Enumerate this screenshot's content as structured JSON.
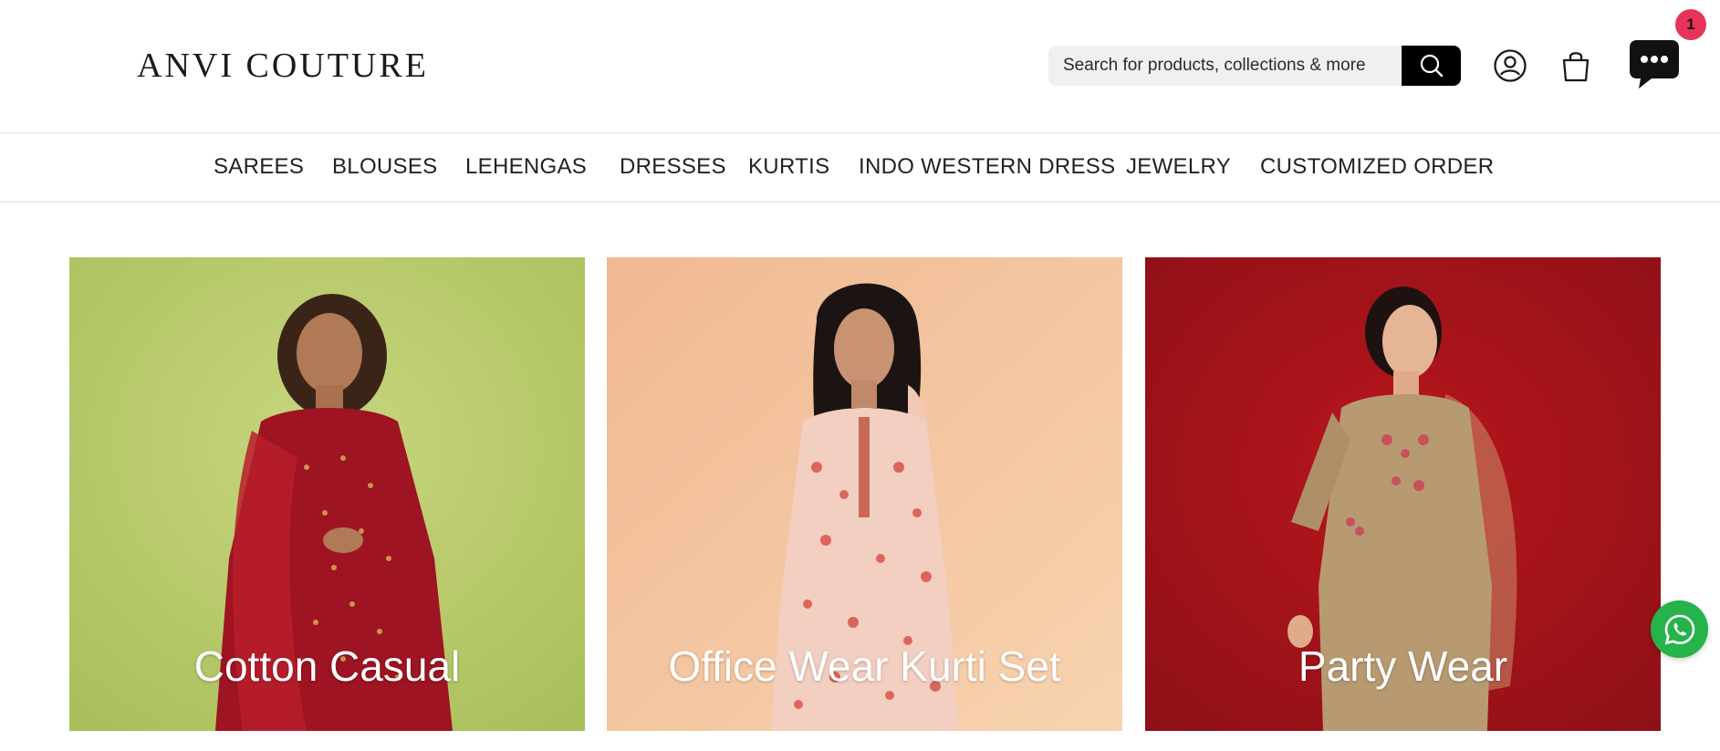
{
  "header": {
    "logo_text": "ANVI COUTURE",
    "search_placeholder": "Search for products, collections & more",
    "icons": {
      "search": "search-icon",
      "account": "user-icon",
      "cart": "shopping-bag-icon",
      "chat": "chat-bubble-icon"
    },
    "chat_badge_count": "1"
  },
  "nav": {
    "items": [
      {
        "label": "SAREES"
      },
      {
        "label": "BLOUSES"
      },
      {
        "label": "LEHENGAS"
      },
      {
        "label": "DRESSES"
      },
      {
        "label": "KURTIS"
      },
      {
        "label": "INDO WESTERN DRESS"
      },
      {
        "label": "JEWELRY"
      },
      {
        "label": "CUSTOMIZED ORDER"
      }
    ]
  },
  "collections": [
    {
      "title": "Cotton Casual",
      "background": "#bfcf72",
      "garment": "#9e1422"
    },
    {
      "title": "Office Wear Kurti Set",
      "background": "#f4c9a3",
      "garment": "#e88a77"
    },
    {
      "title": "Party Wear",
      "background": "#a8151b",
      "garment": "#b89a72"
    }
  ],
  "floating": {
    "whatsapp_icon": "whatsapp-icon"
  },
  "colors": {
    "badge": "#e8345d",
    "whatsapp": "#25b34a",
    "search_button": "#000000"
  }
}
